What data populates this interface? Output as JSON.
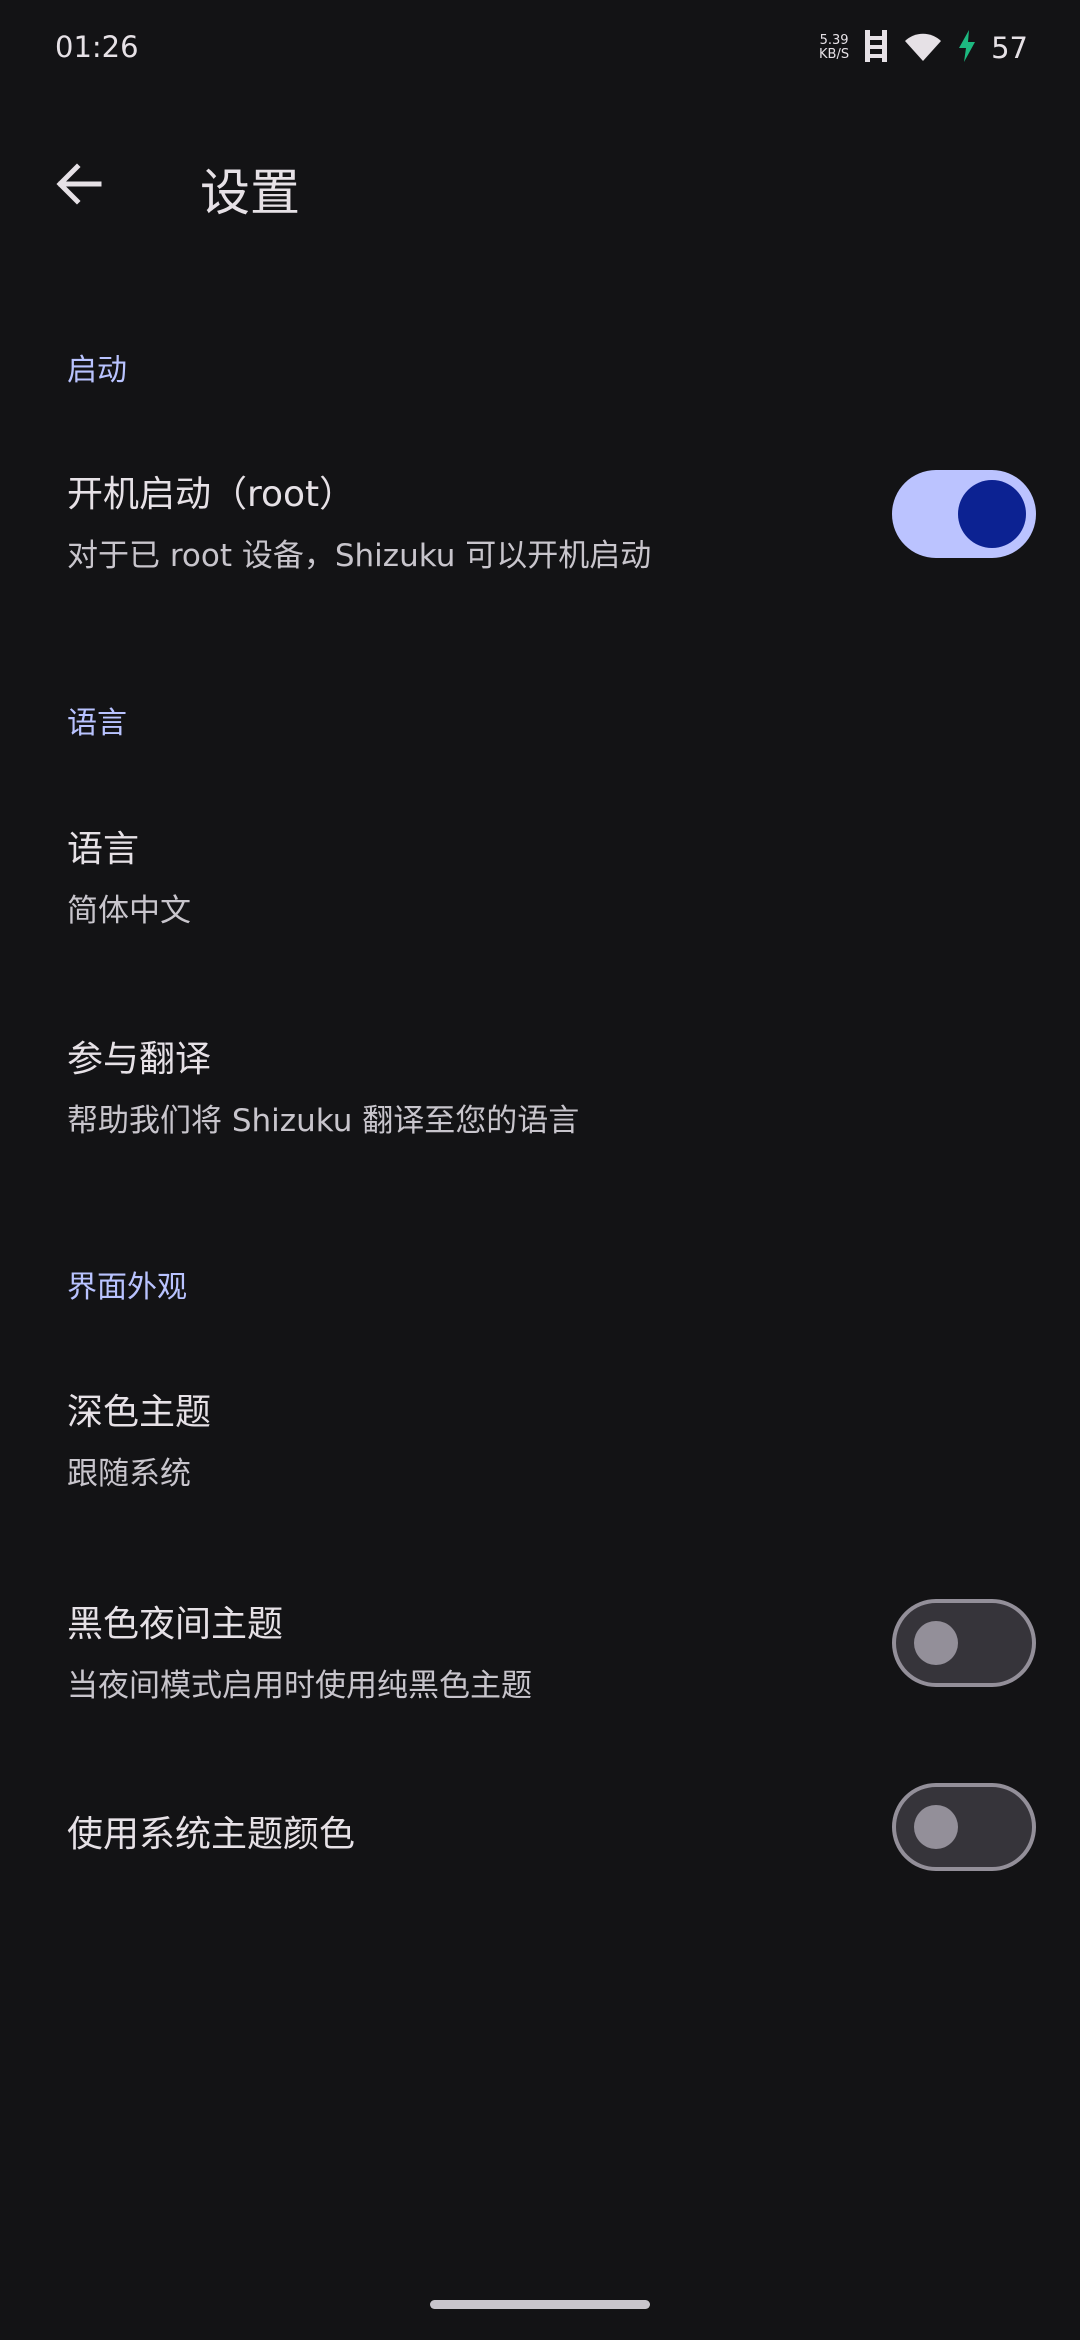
{
  "status_bar": {
    "time": "01:26",
    "net_speed_value": "5.39",
    "net_speed_unit": "KB/S",
    "battery": "57"
  },
  "app_bar": {
    "title": "设置",
    "back_icon": "arrow-back-icon"
  },
  "sections": {
    "startup": {
      "header": "启动",
      "boot_start": {
        "title": "开机启动（root）",
        "summary": "对于已 root 设备，Shizuku 可以开机启动",
        "enabled": true
      }
    },
    "language": {
      "header": "语言",
      "language_item": {
        "title": "语言",
        "summary": "简体中文"
      },
      "translate_item": {
        "title": "参与翻译",
        "summary": "帮助我们将 Shizuku 翻译至您的语言"
      }
    },
    "appearance": {
      "header": "界面外观",
      "dark_theme": {
        "title": "深色主题",
        "summary": "跟随系统"
      },
      "black_night_theme": {
        "title": "黑色夜间主题",
        "summary": "当夜间模式启用时使用纯黑色主题",
        "enabled": false
      },
      "system_colors": {
        "title": "使用系统主题颜色",
        "enabled": false
      }
    }
  },
  "colors": {
    "background": "#131315",
    "accent": "#b9c3ff",
    "switch_on_track": "#bbc3ff",
    "switch_on_thumb": "#0c2292",
    "switch_off_outline": "#938f99",
    "charging": "#1db980"
  }
}
